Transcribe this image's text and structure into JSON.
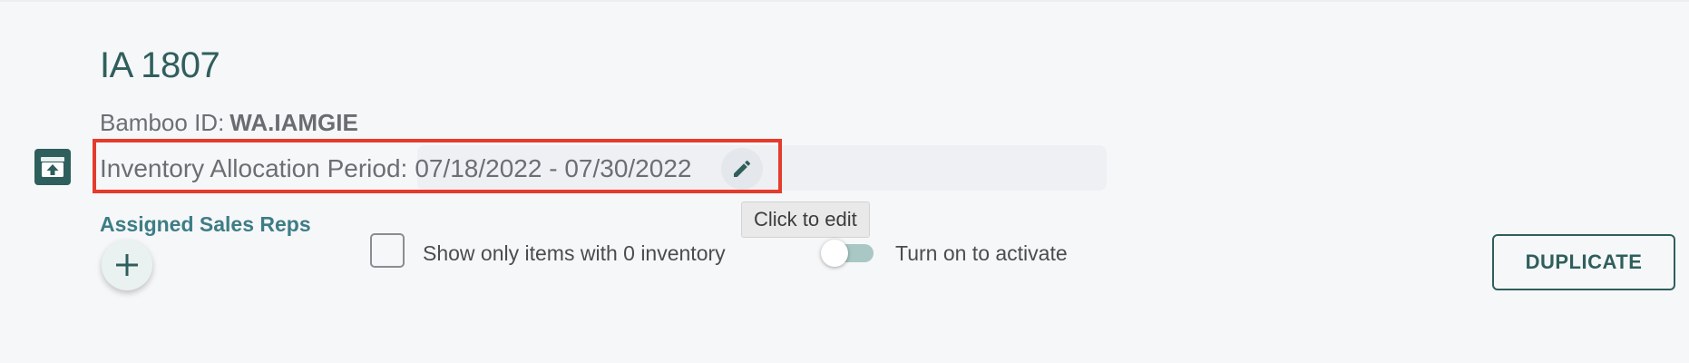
{
  "header": {
    "title": "IA 1807"
  },
  "bamboo": {
    "label": "Bamboo ID:",
    "value": "WA.IAMGIE"
  },
  "allocation_period": {
    "label": "Inventory Allocation Period:",
    "value": "07/18/2022 - 07/30/2022",
    "edit_tooltip": "Click to edit"
  },
  "sales_reps": {
    "label": "Assigned Sales Reps"
  },
  "filters": {
    "zero_inventory_label": "Show only items with 0 inventory",
    "zero_inventory_checked": false
  },
  "activation": {
    "label": "Turn on to activate",
    "active": false
  },
  "actions": {
    "duplicate_label": "DUPLICATE"
  },
  "colors": {
    "accent": "#2f5f5c",
    "link": "#3d7d85",
    "highlight": "#e53b2c"
  },
  "icons": {
    "archive": "archive-upload-icon",
    "edit": "pencil-icon",
    "add": "plus-icon"
  }
}
